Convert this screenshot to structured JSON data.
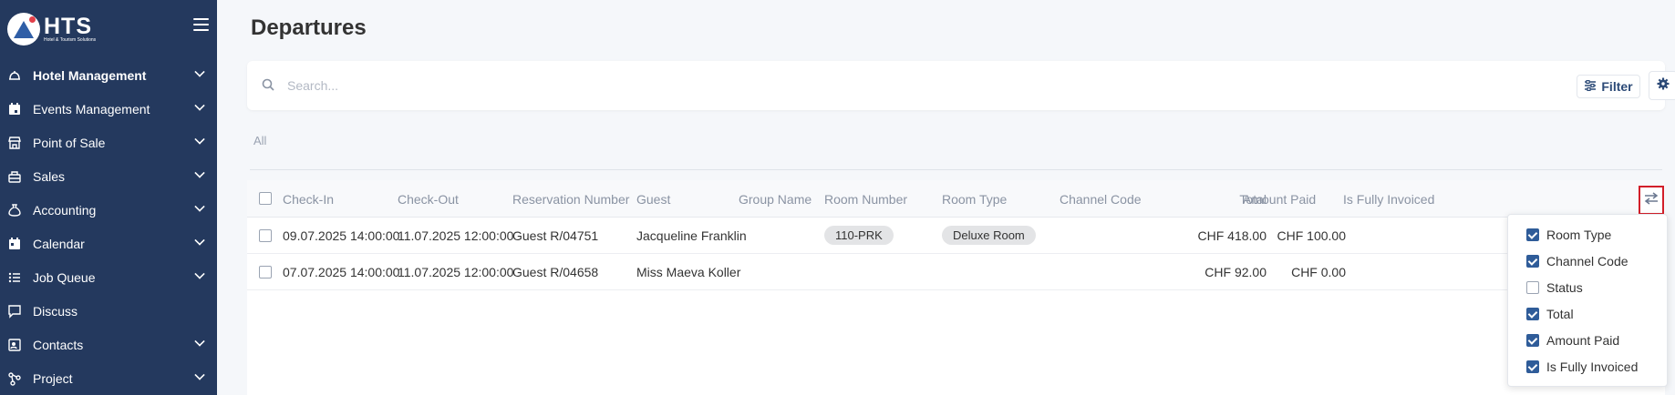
{
  "sidebar": {
    "logo_text": "HTS",
    "logo_subtitle": "Hotel & Tourism Solutions",
    "items": [
      {
        "label": "Hotel Management",
        "icon": "bell-icon"
      },
      {
        "label": "Events Management",
        "icon": "calendar-event-icon"
      },
      {
        "label": "Point of Sale",
        "icon": "store-icon"
      },
      {
        "label": "Sales",
        "icon": "sales-icon"
      },
      {
        "label": "Accounting",
        "icon": "money-bag-icon"
      },
      {
        "label": "Calendar",
        "icon": "calendar-icon"
      },
      {
        "label": "Job Queue",
        "icon": "list-icon"
      },
      {
        "label": "Discuss",
        "icon": "chat-icon"
      },
      {
        "label": "Contacts",
        "icon": "contact-card-icon"
      },
      {
        "label": "Project",
        "icon": "project-icon"
      }
    ]
  },
  "page": {
    "title": "Departures"
  },
  "search": {
    "placeholder": "Search...",
    "value": ""
  },
  "toolbar": {
    "filter_label": "Filter"
  },
  "tabs": {
    "all": "All"
  },
  "table": {
    "headers": {
      "check_in": "Check-In",
      "check_out": "Check-Out",
      "reservation_number": "Reservation Number",
      "guest": "Guest",
      "group_name": "Group Name",
      "room_number": "Room Number",
      "room_type": "Room Type",
      "channel_code": "Channel Code",
      "total": "Total",
      "amount_paid": "Amount Paid",
      "is_fully_invoiced": "Is Fully Invoiced"
    },
    "rows": [
      {
        "check_in": "09.07.2025 14:00:00",
        "check_out": "11.07.2025 12:00:00",
        "reservation_number": "Guest R/04751",
        "guest": "Jacqueline Franklin",
        "group_name": "",
        "room_number": "110-PRK",
        "room_type": "Deluxe Room",
        "channel_code": "",
        "total": "CHF 418.00",
        "amount_paid": "CHF 100.00"
      },
      {
        "check_in": "07.07.2025 14:00:00",
        "check_out": "11.07.2025 12:00:00",
        "reservation_number": "Guest R/04658",
        "guest": "Miss Maeva Koller",
        "group_name": "",
        "room_number": "",
        "room_type": "",
        "channel_code": "",
        "total": "CHF 92.00",
        "amount_paid": "CHF 0.00"
      }
    ]
  },
  "column_menu": {
    "items": [
      {
        "label": "Room Type",
        "checked": true
      },
      {
        "label": "Channel Code",
        "checked": true
      },
      {
        "label": "Status",
        "checked": false
      },
      {
        "label": "Total",
        "checked": true
      },
      {
        "label": "Amount Paid",
        "checked": true
      },
      {
        "label": "Is Fully Invoiced",
        "checked": true
      }
    ]
  },
  "colors": {
    "sidebar_bg": "#24395e",
    "accent": "#2f5c99",
    "highlight": "#d21f2a"
  }
}
